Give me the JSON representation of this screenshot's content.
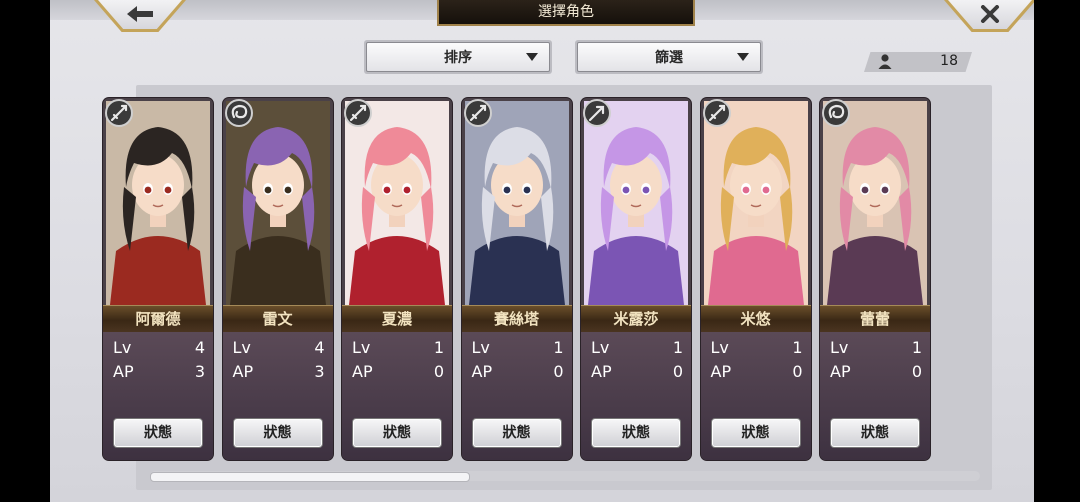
{
  "header": {
    "title": "選擇角色"
  },
  "controls": {
    "sort_label": "排序",
    "filter_label": "篩選",
    "character_count": "18"
  },
  "labels": {
    "lv": "Lv",
    "ap": "AP",
    "status": "狀態"
  },
  "characters": [
    {
      "name": "阿爾德",
      "lv": "4",
      "ap": "3",
      "weapon": "sword-icon",
      "hair": "#2b2522",
      "accent": "#9b2a20",
      "bg": "#c9b9a6"
    },
    {
      "name": "雷文",
      "lv": "4",
      "ap": "3",
      "weapon": "swirl-icon",
      "hair": "#8a64b2",
      "accent": "#3a2e1e",
      "bg": "#5c4f3a"
    },
    {
      "name": "夏濃",
      "lv": "1",
      "ap": "0",
      "weapon": "sword-icon",
      "hair": "#ef8a98",
      "accent": "#b0212e",
      "bg": "#f3e8e6"
    },
    {
      "name": "賽絲塔",
      "lv": "1",
      "ap": "0",
      "weapon": "sword-icon",
      "hair": "#dcdde6",
      "accent": "#2a3152",
      "bg": "#9fa4b8"
    },
    {
      "name": "米露莎",
      "lv": "1",
      "ap": "0",
      "weapon": "arrow-icon",
      "hair": "#c596e6",
      "accent": "#7b55b4",
      "bg": "#e3d2f0"
    },
    {
      "name": "米悠",
      "lv": "1",
      "ap": "0",
      "weapon": "sword-icon",
      "hair": "#e0b05a",
      "accent": "#e06a90",
      "bg": "#f2d5c2"
    },
    {
      "name": "蕾蕾",
      "lv": "1",
      "ap": "0",
      "weapon": "swirl-icon",
      "hair": "#e28aa6",
      "accent": "#5a3a54",
      "bg": "#d9c3b3"
    }
  ]
}
